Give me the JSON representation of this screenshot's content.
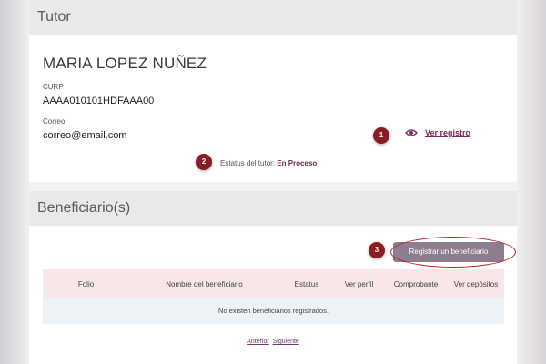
{
  "tutor_section": {
    "title": "Tutor",
    "name": "MARIA LOPEZ NUÑEZ",
    "curp_label": "CURP",
    "curp_value": "AAAA010101HDFAAA00",
    "email_label": "Correo:",
    "email_value": "correo@email.com",
    "ver_registro_label": "Ver registro",
    "status_label": "Estatus del tutor:",
    "status_value": "En Proceso"
  },
  "beneficiarios_section": {
    "title": "Beneficiario(s)",
    "register_button_label": "Registrar un beneficiario",
    "table": {
      "columns": [
        "Folio",
        "Nombre del beneficiario",
        "Estatus",
        "Ver perfil",
        "Comprobante",
        "Ver depósitos"
      ],
      "empty_message": "No existen beneficiarios registrados."
    },
    "pagination": {
      "previous_label": "Anterior",
      "next_label": "Siguiente"
    }
  },
  "annotations": {
    "badge_1": "1",
    "badge_2": "2",
    "badge_3": "3"
  },
  "colors": {
    "accent": "#7b2a5b",
    "badge": "#8a1c24",
    "button": "#8e7c8f",
    "table_header": "#f8e6e8",
    "highlight_ellipse": "#c12020"
  },
  "icons": {
    "ver_registro": "eye-icon"
  }
}
